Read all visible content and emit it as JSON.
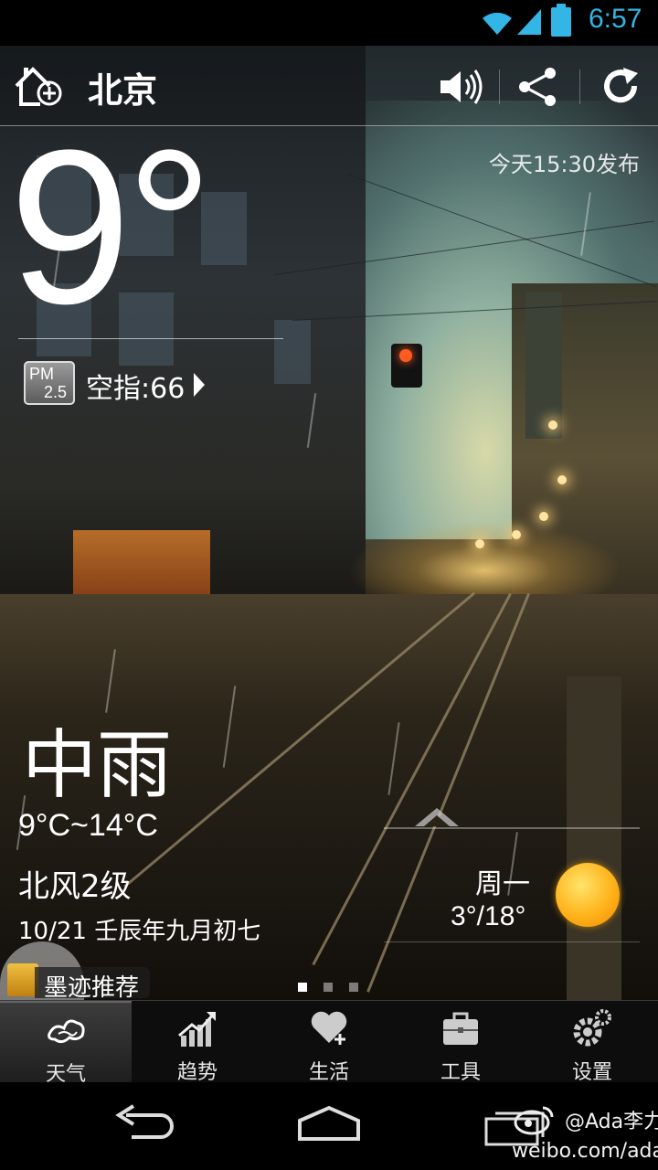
{
  "status_bar": {
    "time": "6:57",
    "icons": [
      "wifi-icon",
      "signal-icon",
      "battery-icon"
    ],
    "accent": "#33b5e5"
  },
  "header": {
    "city": "北京",
    "icons": [
      "add-city-icon",
      "speaker-icon",
      "share-icon",
      "refresh-icon"
    ]
  },
  "current": {
    "publish_time": "今天15:30发布",
    "temperature": "9°",
    "aqi_label": "空指:66",
    "condition": "中雨",
    "range": "9°C~14°C",
    "wind": "北风2级",
    "date": "10/21 壬辰年九月初七"
  },
  "pm_badge": {
    "top": "PM",
    "bottom": "2.5"
  },
  "forecast": {
    "day": "周一",
    "range": "3°/18°",
    "icon": "sun-icon"
  },
  "promo": {
    "label": "墨迹推荐"
  },
  "pager": {
    "count": 3,
    "active": 0
  },
  "tabs": [
    {
      "label": "天气",
      "icon": "cloud-icon",
      "active": true
    },
    {
      "label": "趋势",
      "icon": "trend-chart-icon",
      "active": false
    },
    {
      "label": "生活",
      "icon": "heart-plus-icon",
      "active": false
    },
    {
      "label": "工具",
      "icon": "toolbox-icon",
      "active": false
    },
    {
      "label": "设置",
      "icon": "gears-icon",
      "active": false
    }
  ],
  "navbar": {
    "icons": [
      "back-icon",
      "home-icon",
      "recent-apps-icon"
    ]
  },
  "watermark": {
    "handle": "@Ada李力",
    "url": "weibo.com/adali"
  }
}
